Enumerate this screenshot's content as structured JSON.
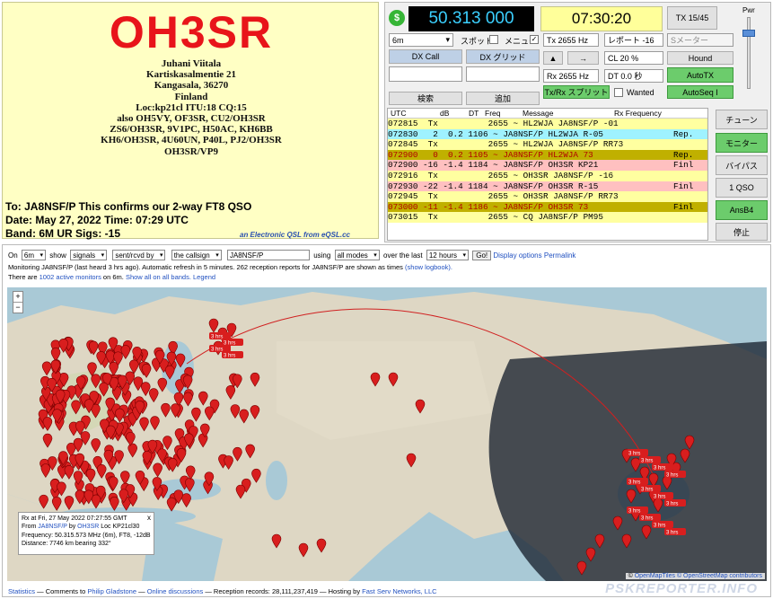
{
  "qsl": {
    "callsign": "OH3SR",
    "address_lines": [
      "Juhani Viitala",
      "Kartiskasalmentie 21",
      "Kangasala, 36270",
      "Finland",
      "Loc:kp21cl ITU:18 CQ:15",
      "also OH5VY, OF3SR, CU2/OH3SR",
      "ZS6/OH3SR, 9V1PC, H50AC, KH6BB",
      "KH6/OH3SR, 4U60UN, P40L, PJ2/OH3SR",
      "OH3SR/VP9"
    ],
    "confirm_line": "To: JA8NSF/P This confirms our 2-way FT8 QSO",
    "date_line": "Date: May 27, 2022  Time: 07:29 UTC",
    "band_line": "Band: 6M UR Sigs: -15",
    "eqsl_note": "an Electronic QSL from eQSL.cc"
  },
  "wsjt": {
    "dollar": "$",
    "frequency": "50.313 000",
    "clock": "07:30:20",
    "tx_counter": "TX 15/45",
    "pwr_label": "Pwr",
    "band": "6m",
    "spot_label": "スポット",
    "menu_label": "メニュー",
    "tx_freq": "Tx  2655  Hz",
    "report": "レポート -16",
    "s_meter": "Sメーター",
    "dx_call_label": "DX Call",
    "dx_grid_label": "DX グリッド",
    "cl_field": "CL  20 %",
    "hound_label": "Hound",
    "rx_freq": "Rx  2655  Hz",
    "dt_field": "DT 0.0 秒",
    "autotx_label": "AutoTX",
    "search_label": "検索",
    "add_label": "追加",
    "txrx_split_label": "Tx/Rx スプリット",
    "wanted_label": "Wanted",
    "autoseq_label": "AutoSeq I",
    "tune_label": "チューン",
    "monitor_label": "モニター",
    "bypass_label": "バイパス",
    "qso1_label": "1 QSO",
    "ansb4_label": "AnsB4",
    "stop_label": "停止",
    "headers": {
      "utc": "UTC",
      "db": "dB",
      "dt": "DT",
      "freq": "Freq",
      "message": "Message",
      "rx_freq": "Rx Frequency"
    },
    "rows": [
      {
        "text": "072815  Tx          2655 ~ HL2WJA JA8NSF/P -01",
        "tail": "",
        "bg": "#ffffa0",
        "fg": "#000"
      },
      {
        "text": "072830   2  0.2 1106 ~ JA8NSF/P HL2WJA R-05",
        "tail": "Rep.",
        "bg": "#9ff2ff",
        "fg": "#000"
      },
      {
        "text": "072845  Tx          2655 ~ HL2WJA JA8NSF/P RR73",
        "tail": "",
        "bg": "#ffffa0",
        "fg": "#000"
      },
      {
        "text": "072900   0  0.2 1105 ~ JA8NSF/P HL2WJA 73",
        "tail": "Rep.",
        "bg": "#c0b000",
        "fg": "#b00000"
      },
      {
        "text": "072900 -16 -1.4 1184 ~ JA8NSF/P OH3SR KP21",
        "tail": "Finl",
        "bg": "#ffc0c0",
        "fg": "#000"
      },
      {
        "text": "072916  Tx          2655 ~ OH3SR JA8NSF/P -16",
        "tail": "",
        "bg": "#ffffa0",
        "fg": "#000"
      },
      {
        "text": "072930 -22 -1.4 1184 ~ JA8NSF/P OH3SR R-15",
        "tail": "Finl",
        "bg": "#ffc0c0",
        "fg": "#000"
      },
      {
        "text": "072945  Tx          2655 ~ OH3SR JA8NSF/P RR73",
        "tail": "",
        "bg": "#ffffa0",
        "fg": "#000"
      },
      {
        "text": "073000 -11 -1.4 1186 ~ JA8NSF/P OH3SR 73",
        "tail": "Finl",
        "bg": "#c0b000",
        "fg": "#b00000"
      },
      {
        "text": "073015  Tx          2655 ~ CQ JA8NSF/P PM95",
        "tail": "",
        "bg": "#ffffa0",
        "fg": "#000"
      }
    ]
  },
  "psk": {
    "on_label": "On",
    "band": "6m",
    "show_label": "show",
    "what": "signals",
    "direction": "sent/rcvd by",
    "match": "the callsign",
    "callsign": "JA8NSF/P",
    "using_label": "using",
    "mode": "all modes",
    "over_label": "over the last",
    "period": "12 hours",
    "go_label": "Go!",
    "display_options": "Display options",
    "permalink": "Permalink",
    "info_line_1": "Monitoring JA8NSF/P (last heard 3 hrs ago). Automatic refresh in 5 minutes. 262 reception reports for JA8NSF/P are shown as times",
    "show_logbook": "(show logbook).",
    "info_line_2_a": "There are",
    "active_monitors": "1002 active monitors",
    "info_line_2_b": "on 6m.",
    "show_all": "Show all on all bands.",
    "legend": "Legend",
    "zoom_in": "+",
    "zoom_out": "−",
    "popup": {
      "line1": "Rx at Fri, 27 May 2022 07:27:55 GMT",
      "from_label": "From",
      "from_call": "JA8NSF/P",
      "by_label": "by",
      "by_call": "OH3SR",
      "loc": "Loc KP21cl30",
      "line3": "Frequency: 50.315.573 MHz (6m), FT8, -12dB",
      "line4": "Distance: 7746 km bearing 332°",
      "close": "x"
    },
    "attribution_c": "©",
    "attribution_1": "OpenMapTiles",
    "attribution_2": "© OpenStreetMap contributors",
    "footer": {
      "statistics": "Statistics",
      "comments_to": "— Comments to",
      "comments_name": "Philip Gladstone",
      "sep1": "—",
      "online": "Online discussions",
      "records": "— Reception records: 28,111,237,419 — Hosting by",
      "hosting": "Fast Serv Networks, LLC"
    },
    "brand": "PSKREPORTER.INFO",
    "time_markers": [
      "3 hrs",
      "3 hrs",
      "3 hrs",
      "3 hrs",
      "3 hrs",
      "3 hrs",
      "3 hrs",
      "3 hrs",
      "3 hrs",
      "3 hrs",
      "3 hrs",
      "3 hrs",
      "3 hrs",
      "3 hrs",
      "3 hrs",
      "3 hrs"
    ]
  }
}
